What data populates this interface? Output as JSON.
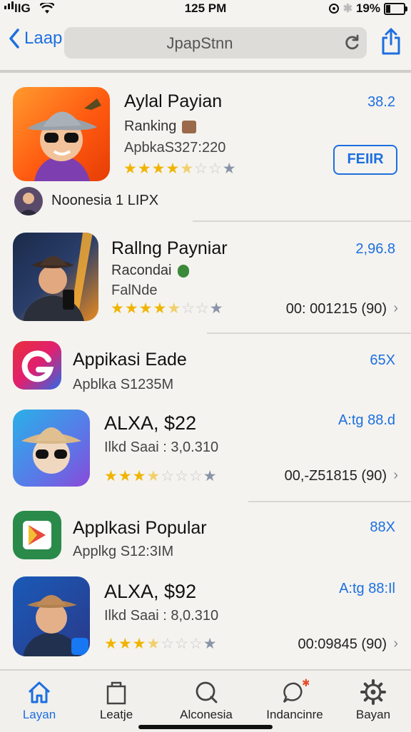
{
  "status": {
    "carrier": "IIG",
    "time": "125 PM",
    "battery": "19%"
  },
  "nav": {
    "back_label": "Laap",
    "url": "JpapStnn"
  },
  "list": {
    "featured": {
      "title": "Aylal Payian",
      "subtitle": "Ranking",
      "detail": "ApbkaS327:220",
      "price": "38.2",
      "button": "FEIIR",
      "rating": 4.5,
      "footer": "Noonesia  1 LIPX"
    },
    "item2": {
      "title": "Rallng Payniar",
      "subtitle": "Racondai",
      "detail": "FalNde",
      "price": "2,96.8",
      "meta": "00: 001215 (90)",
      "rating": 4.5
    },
    "section1": {
      "title": "Appikasi Eade",
      "subtitle": "Apblka S1235M",
      "count": "65X"
    },
    "item3": {
      "title": "ALXA, $22",
      "subtitle": "Ilkd Saai : 3,0.310",
      "price": "A:tg 88.d",
      "meta": "00,-Z51815 (90)",
      "rating": 3.5
    },
    "section2": {
      "title": "Applkasi Popular",
      "subtitle": "Applkg S12:3IM",
      "count": "88X"
    },
    "item4": {
      "title": "ALXA, $92",
      "subtitle": "Ilkd Saai : 8,0.310",
      "price": "A:tg 88:Il",
      "meta": "00:09845 (90)",
      "rating": 3.5
    }
  },
  "tabs": [
    {
      "label": "Layan",
      "icon": "home-icon",
      "active": true
    },
    {
      "label": "Leatje",
      "icon": "bag-icon",
      "active": false
    },
    {
      "label": "Alconesia",
      "icon": "search-icon",
      "active": false
    },
    {
      "label": "Indancinre",
      "icon": "chat-icon",
      "active": false
    },
    {
      "label": "Bayan",
      "icon": "gear-icon",
      "active": false
    }
  ],
  "colors": {
    "accent": "#1d6fe0",
    "star": "#f0b400",
    "background": "#f4f3ef"
  }
}
